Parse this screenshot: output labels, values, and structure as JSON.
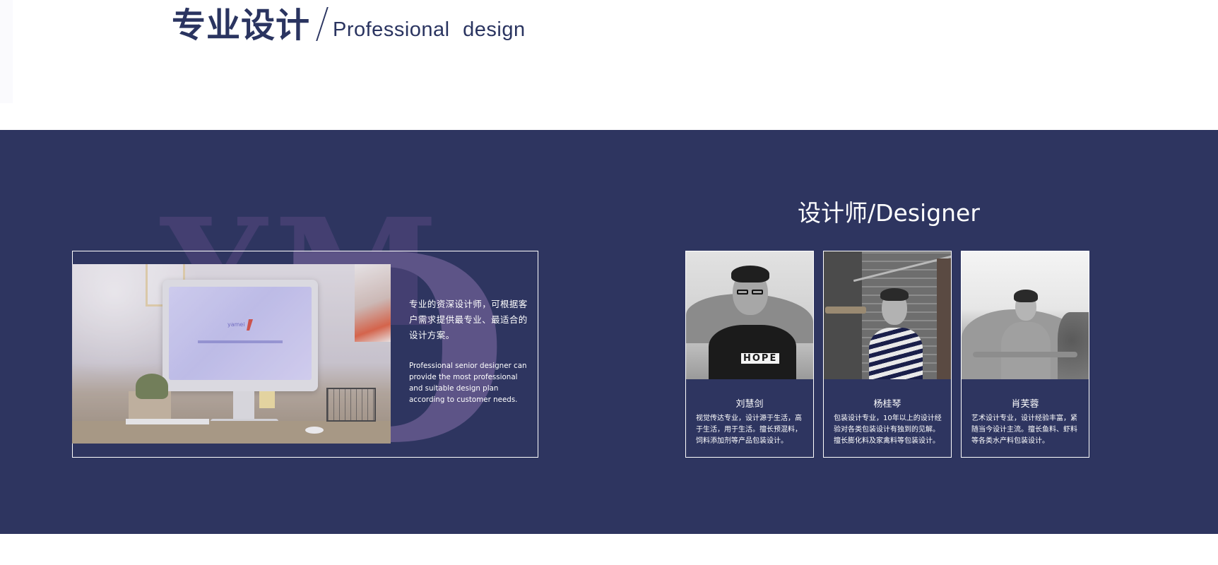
{
  "header": {
    "title_cn": "专业设计",
    "title_en": "Professional  design"
  },
  "watermark": {
    "letter_y": "Y",
    "letter_m": "M",
    "letter_d": "D"
  },
  "intro": {
    "text_cn": "专业的资深设计师，可根据客户需求提供最专业、最适合的设计方案。",
    "text_en": "Professional senior designer can provide the most professional and suitable design plan according to customer needs."
  },
  "screen": {
    "logo_text": "yamei"
  },
  "designers_section": {
    "title": "设计师/Designer",
    "cards": [
      {
        "name": "刘慧剑",
        "description": "视觉传达专业，设计源于生活，高于生活，用于生活。擅长预混料，饲料添加剂等产品包装设计。",
        "shirt_text": "HOPE"
      },
      {
        "name": "杨桂琴",
        "description": "包装设计专业，10年以上的设计经验对各类包装设计有独到的见解。擅长膨化料及家禽料等包装设计。"
      },
      {
        "name": "肖芙蓉",
        "description": "艺术设计专业，设计经验丰富，紧随当今设计主流。擅长鱼料、虾料等各类水产料包装设计。"
      }
    ]
  },
  "colors": {
    "brand_navy": "#2e3560",
    "title_navy": "#2a3460",
    "watermark_purple": "#5d5487",
    "text_white": "#ffffff"
  }
}
